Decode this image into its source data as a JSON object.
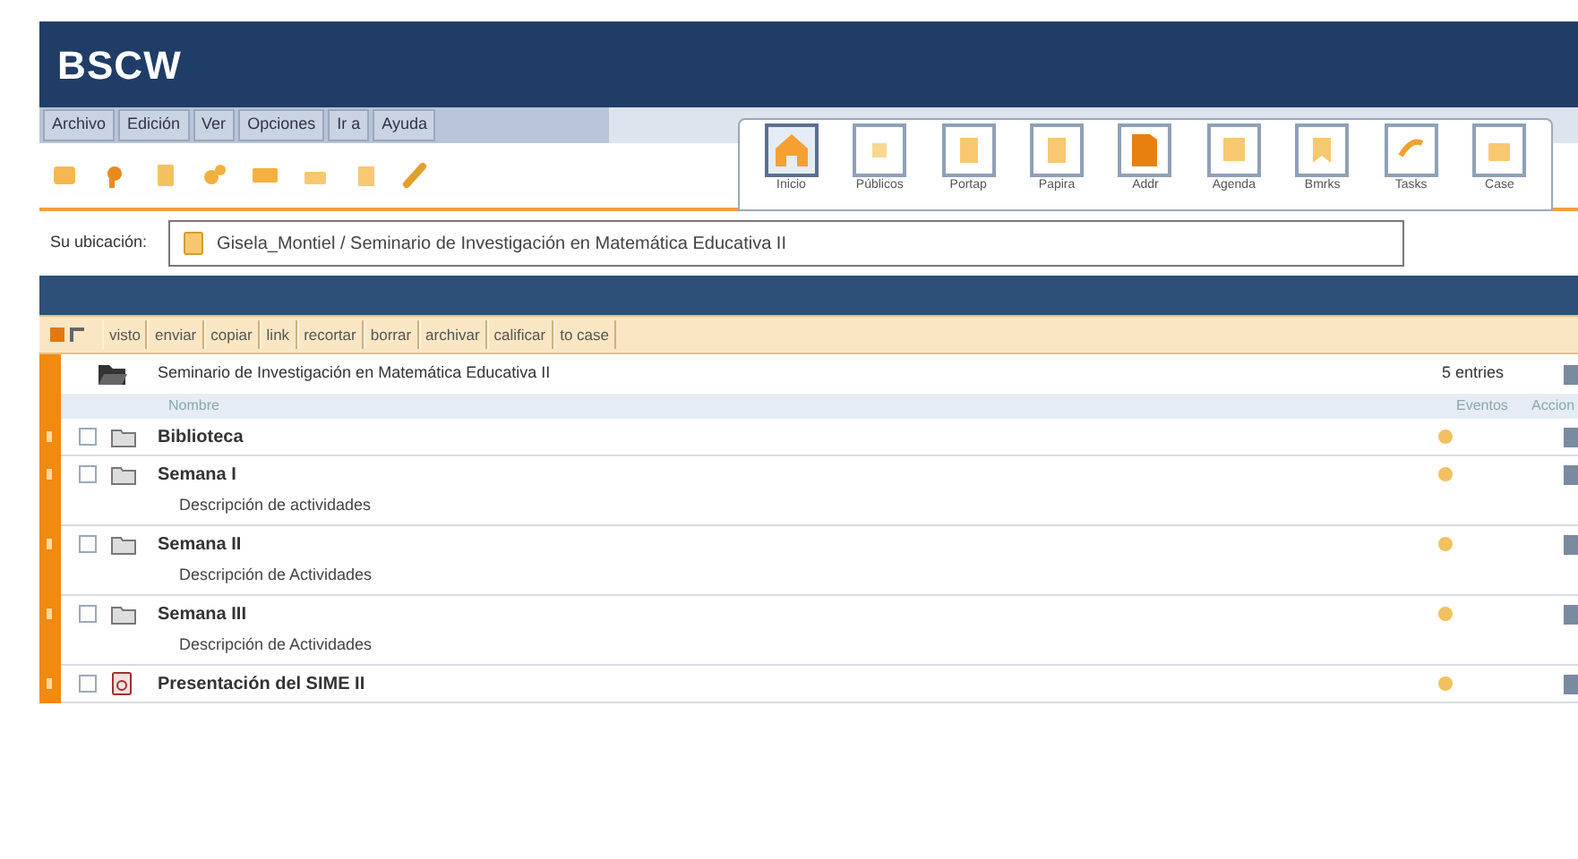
{
  "app": {
    "logo": "BSCW"
  },
  "menu": [
    "Archivo",
    "Edición",
    "Ver",
    "Opciones",
    "Ir a",
    "Ayuda"
  ],
  "shortcuts": [
    {
      "label": "Inicio",
      "selected": true
    },
    {
      "label": "Públicos",
      "selected": false
    },
    {
      "label": "Portap",
      "selected": false
    },
    {
      "label": "Papira",
      "selected": false
    },
    {
      "label": "Addr",
      "selected": false
    },
    {
      "label": "Agenda",
      "selected": false
    },
    {
      "label": "Bmrks",
      "selected": false
    },
    {
      "label": "Tasks",
      "selected": false
    },
    {
      "label": "Case",
      "selected": false
    }
  ],
  "location": {
    "label": "Su ubicación:",
    "path": "Gisela_Montiel / Seminario de Investigación en Matemática Educativa II"
  },
  "actions": [
    "visto",
    "enviar",
    "copiar",
    "link",
    "recortar",
    "borrar",
    "archivar",
    "calificar",
    "to case"
  ],
  "folder": {
    "title": "Seminario de Investigación en Matemática Educativa II",
    "count": "5 entries"
  },
  "columns": [
    "Nombre",
    "Eventos",
    "Accion"
  ],
  "rows": [
    {
      "kind": "folder",
      "name": "Biblioteca",
      "checked": false
    },
    {
      "kind": "folder",
      "name": "Semana I",
      "description": "Descripción de actividades",
      "checked": false
    },
    {
      "kind": "folder",
      "name": "Semana II",
      "description": "Descripción de Actividades",
      "checked": false
    },
    {
      "kind": "folder",
      "name": "Semana III",
      "description": "Descripción de Actividades",
      "checked": false
    },
    {
      "kind": "presentation",
      "name": "Presentación del SIME II",
      "checked": false
    }
  ]
}
